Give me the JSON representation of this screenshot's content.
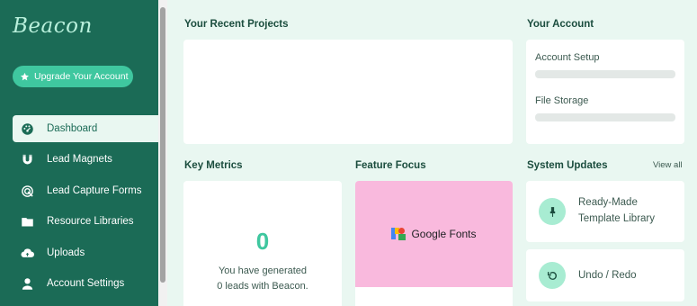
{
  "sidebar": {
    "logo": "Beacon",
    "upgrade_label": "Upgrade Your Account",
    "items": [
      {
        "label": "Dashboard",
        "icon": "dashboard-icon"
      },
      {
        "label": "Lead Magnets",
        "icon": "magnet-icon"
      },
      {
        "label": "Lead Capture Forms",
        "icon": "capture-form-icon"
      },
      {
        "label": "Resource Libraries",
        "icon": "folder-icon"
      },
      {
        "label": "Uploads",
        "icon": "cloud-upload-icon"
      },
      {
        "label": "Account Settings",
        "icon": "user-icon"
      }
    ],
    "active_item": "Dashboard"
  },
  "recent_projects": {
    "title": "Your Recent Projects"
  },
  "account": {
    "title": "Your Account",
    "items": [
      {
        "label": "Account Setup"
      },
      {
        "label": "File Storage"
      }
    ]
  },
  "metrics": {
    "title": "Key Metrics",
    "value": "0",
    "line1": "You have generated",
    "line2": "0 leads with Beacon."
  },
  "feature": {
    "title": "Feature Focus",
    "brand": "Google Fonts"
  },
  "updates": {
    "title": "System Updates",
    "view_all": "View all",
    "items": [
      {
        "line1": "Ready-Made",
        "line2": "Template Library",
        "icon": "paintbrush-icon"
      },
      {
        "line1": "Undo / Redo",
        "icon": "undo-icon"
      }
    ]
  },
  "colors": {
    "sidebar": "#1b6b56",
    "accent": "#3fc79f",
    "background": "#e9f7f1",
    "feature_bg": "#f9b9dd"
  }
}
